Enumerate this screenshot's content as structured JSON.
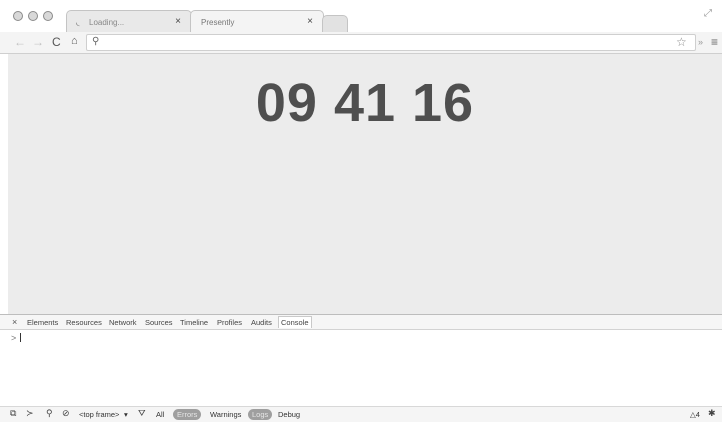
{
  "tabs": [
    {
      "title": "Loading...",
      "loading": true
    },
    {
      "title": "Presently",
      "loading": false
    }
  ],
  "toolbar": {
    "back_icon": "←",
    "forward_icon": "→",
    "reload_icon": "C",
    "home_icon": "⌂",
    "search_icon": "⚲",
    "star_icon": "☆",
    "overflow_icon": "»",
    "menu_icon": "≡",
    "omnibox_value": ""
  },
  "page": {
    "clock": "09 41 16"
  },
  "devtools": {
    "close_icon": "×",
    "tabs": [
      "Elements",
      "Resources",
      "Network",
      "Sources",
      "Timeline",
      "Profiles",
      "Audits",
      "Console"
    ],
    "active_tab": "Console",
    "prompt": ">",
    "status": {
      "frame": "<top frame>",
      "frame_arrow": "▾",
      "filters": [
        "All",
        "Errors",
        "Warnings",
        "Logs",
        "Debug"
      ],
      "warning_count": "4"
    }
  }
}
